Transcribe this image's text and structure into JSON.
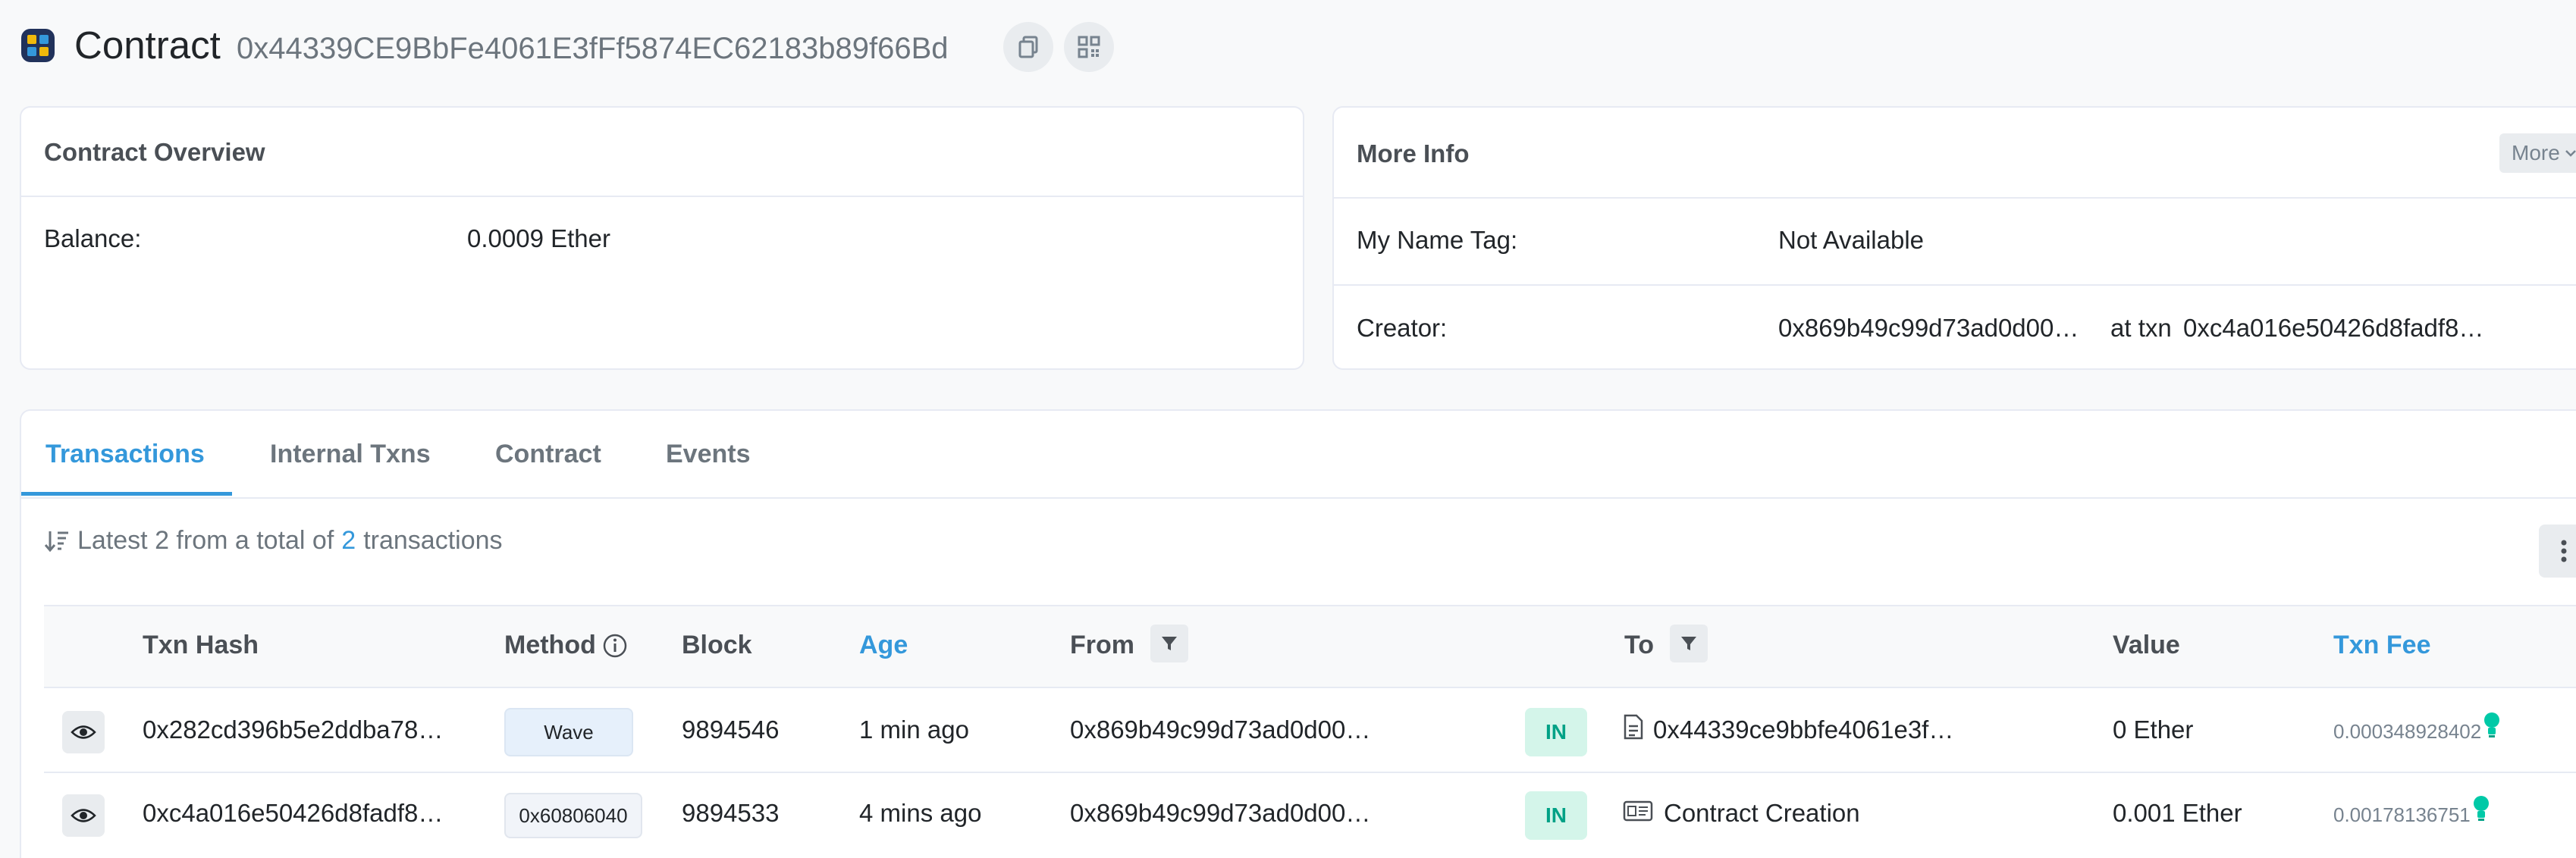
{
  "header": {
    "title": "Contract",
    "address": "0x44339CE9BbFe4061E3fFf5874EC62183b89f66Bd"
  },
  "overview": {
    "title": "Contract Overview",
    "balance_label": "Balance:",
    "balance_value": "0.0009 Ether"
  },
  "more_info": {
    "title": "More Info",
    "more_button": "More",
    "name_tag_label": "My Name Tag:",
    "name_tag_value": "Not Available",
    "creator_label": "Creator:",
    "creator_address": "0x869b49c99d73ad0d00…",
    "at_txn": "at txn",
    "creator_txn": "0xc4a016e50426d8fadf8…"
  },
  "tabs": [
    "Transactions",
    "Internal Txns",
    "Contract",
    "Events"
  ],
  "summary": {
    "prefix": "Latest 2 from a total of",
    "count": "2",
    "suffix": "transactions"
  },
  "columns": {
    "txn_hash": "Txn Hash",
    "method": "Method",
    "block": "Block",
    "age": "Age",
    "from": "From",
    "to": "To",
    "value": "Value",
    "txn_fee": "Txn Fee"
  },
  "rows": [
    {
      "hash": "0x282cd396b5e2ddba78…",
      "method": "Wave",
      "block": "9894546",
      "age": "1 min ago",
      "from": "0x869b49c99d73ad0d00…",
      "direction": "IN",
      "to": "0x44339ce9bbfe4061e3f…",
      "value": "0 Ether",
      "fee": "0.000348928402"
    },
    {
      "hash": "0xc4a016e50426d8fadf8…",
      "method": "0x60806040",
      "block": "9894533",
      "age": "4 mins ago",
      "from": "0x869b49c99d73ad0d00…",
      "direction": "IN",
      "to": "Contract Creation",
      "value": "0.001 Ether",
      "fee": "0.00178136751"
    }
  ],
  "colors": {
    "link": "#3498db",
    "in_badge_bg": "#d4f5ea",
    "in_badge_text": "#00a186",
    "fee_bulb": "#00c9a7"
  }
}
